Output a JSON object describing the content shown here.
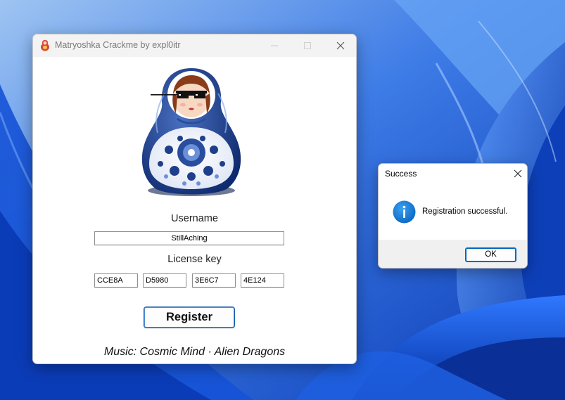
{
  "main_window": {
    "title": "Matryoshka Crackme by expl0itr",
    "username_label": "Username",
    "username_value": "StillAching",
    "license_label": "License key",
    "license_parts": [
      "CCE8A",
      "D5980",
      "3E6C7",
      "4E124"
    ],
    "register_label": "Register",
    "music_text": "Music: Cosmic Mind · Alien Dragons"
  },
  "dialog": {
    "title": "Success",
    "message": "Registration successful.",
    "ok_label": "OK"
  },
  "icons": {
    "app": "matryoshka-icon",
    "minimize": "minimize-icon",
    "maximize": "maximize-icon",
    "close": "close-icon",
    "info": "info-icon"
  },
  "colors": {
    "accent": "#0067c0",
    "wallpaper": "#1a4fd0",
    "doll_blue": "#1e3f8a"
  }
}
